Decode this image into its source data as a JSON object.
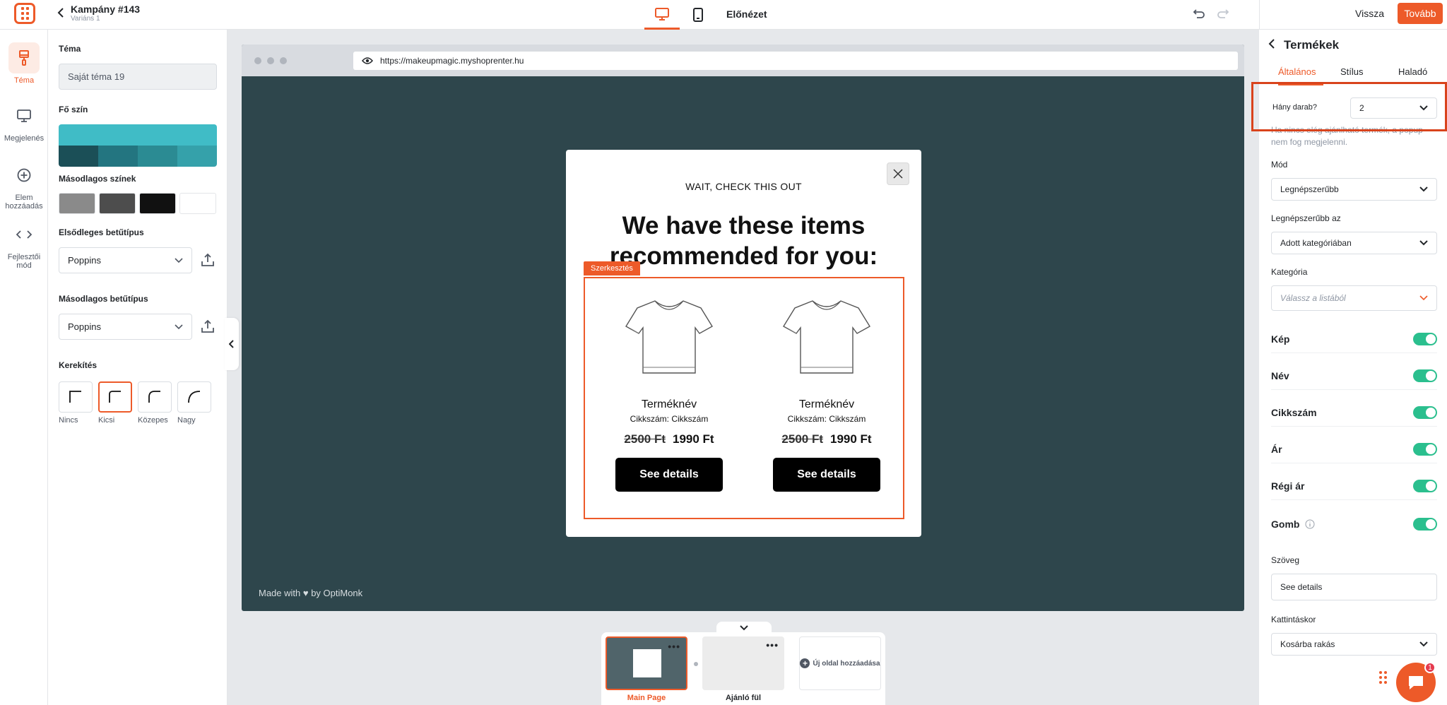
{
  "header": {
    "campaign_title": "Kampány #143",
    "variant": "Variáns 1",
    "preview_label": "Előnézet",
    "back_label": "Vissza",
    "next_label": "Tovább"
  },
  "rail": {
    "items": [
      {
        "label": "Téma",
        "icon": "brush-icon",
        "active": true
      },
      {
        "label": "Megjelenés",
        "icon": "monitor-icon"
      },
      {
        "label": "Elem hozzáadás",
        "icon": "plus-circle-icon"
      },
      {
        "label": "Fejlesztői mód",
        "icon": "code-icon"
      }
    ]
  },
  "theme_panel": {
    "theme_label": "Téma",
    "theme_value": "Saját téma 19",
    "main_color_label": "Fő szín",
    "main_color": "#40bcc6",
    "main_color_shades": [
      "#1b4f57",
      "#237580",
      "#2b8b93",
      "#35a1aa"
    ],
    "secondary_colors_label": "Másodlagos színek",
    "secondary_colors": [
      "#8a8a8a",
      "#4d4d4d",
      "#111111",
      "#ffffff"
    ],
    "primary_font_label": "Elsődleges betűtípus",
    "primary_font_value": "Poppins",
    "secondary_font_label": "Másodlagos betűtípus",
    "secondary_font_value": "Poppins",
    "rounding_label": "Kerekítés",
    "rounding_options": [
      {
        "label": "Nincs"
      },
      {
        "label": "Kicsi",
        "active": true
      },
      {
        "label": "Közepes"
      },
      {
        "label": "Nagy"
      }
    ]
  },
  "browser": {
    "url": "https://makeupmagic.myshoprenter.hu",
    "made_with": "Made with ♥ by OptiMonk"
  },
  "popup": {
    "subtitle": "WAIT, CHECK THIS OUT",
    "title": "We have these items recommended for you:",
    "edit_tag": "Szerkesztés",
    "products": [
      {
        "name": "Terméknév",
        "sku": "Cikkszám: Cikkszám",
        "old_price": "2500 Ft",
        "price": "1990 Ft",
        "button": "See details"
      },
      {
        "name": "Terméknév",
        "sku": "Cikkszám: Cikkszám",
        "old_price": "2500 Ft",
        "price": "1990 Ft",
        "button": "See details"
      }
    ]
  },
  "pages": {
    "main_label": "Main Page",
    "side_label": "Ajánló fül",
    "add_label": "Új oldal hozzáadása"
  },
  "right_panel": {
    "title": "Termékek",
    "tabs": [
      "Általános",
      "Stílus",
      "Haladó"
    ],
    "qty_label": "Hány darab?",
    "qty_value": "2",
    "qty_hint": "Ha nincs elég ajánlható termék, a popup nem fog megjelenni.",
    "mode_label": "Mód",
    "mode_value": "Legnépszerűbb",
    "popular_in_label": "Legnépszerűbb az",
    "popular_in_value": "Adott kategóriában",
    "category_label": "Kategória",
    "category_placeholder": "Válassz a listából",
    "toggles": [
      "Kép",
      "Név",
      "Cikkszám",
      "Ár",
      "Régi ár",
      "Gomb"
    ],
    "text_label": "Szöveg",
    "text_value": "See details",
    "click_label": "Kattintáskor",
    "click_value": "Kosárba rakás",
    "chat_badge": "1"
  }
}
